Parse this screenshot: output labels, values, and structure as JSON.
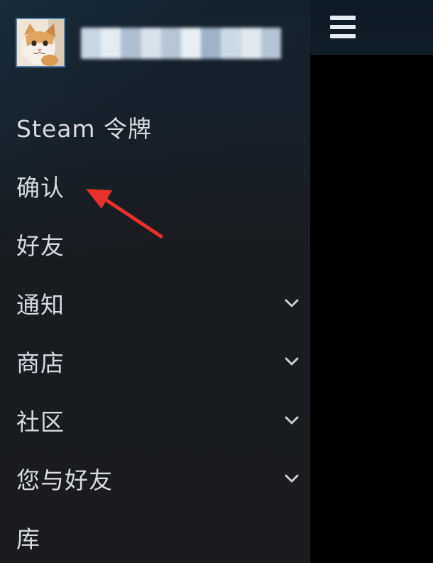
{
  "profile": {
    "username_blurred": true,
    "blur_colors": [
      "#c9d6e2",
      "#e4ebf1",
      "#aebfd0",
      "#d9e2ea",
      "#b7c6d5",
      "#e8eef3",
      "#9fb2c6",
      "#cdd9e4",
      "#e1e8ee",
      "#b4c4d3"
    ]
  },
  "topbar": {
    "menu_icon": "hamburger-menu-icon"
  },
  "menu": {
    "items": [
      {
        "label": "Steam 令牌",
        "has_chevron": false
      },
      {
        "label": "确认",
        "has_chevron": false
      },
      {
        "label": "好友",
        "has_chevron": false
      },
      {
        "label": "通知",
        "has_chevron": true
      },
      {
        "label": "商店",
        "has_chevron": true
      },
      {
        "label": "社区",
        "has_chevron": true
      },
      {
        "label": "您与好友",
        "has_chevron": true
      },
      {
        "label": "库",
        "has_chevron": false
      }
    ]
  },
  "annotation": {
    "arrow_color": "#e8302c",
    "points_to": "确认"
  },
  "colors": {
    "drawer_bg": "#1b1b1d",
    "menu_text": "#d7dbe0",
    "avatar_border": "#4d7aa8",
    "topbar_bg": "#101b26"
  }
}
